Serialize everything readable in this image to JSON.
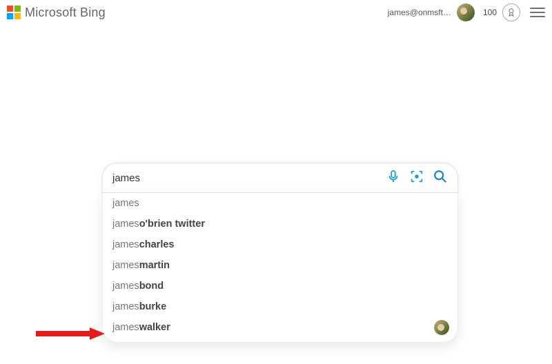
{
  "header": {
    "brand": "Microsoft Bing",
    "user_email": "james@onmsft…",
    "rewards_count": "100"
  },
  "search": {
    "value": "james"
  },
  "suggestions": [
    {
      "prefix": "james",
      "bold": ""
    },
    {
      "prefix": "james ",
      "bold": "o'brien twitter"
    },
    {
      "prefix": "james ",
      "bold": "charles"
    },
    {
      "prefix": "james ",
      "bold": "martin"
    },
    {
      "prefix": "james ",
      "bold": "bond"
    },
    {
      "prefix": "james ",
      "bold": "burke"
    },
    {
      "prefix": "james ",
      "bold": "walker",
      "avatar": true
    }
  ]
}
